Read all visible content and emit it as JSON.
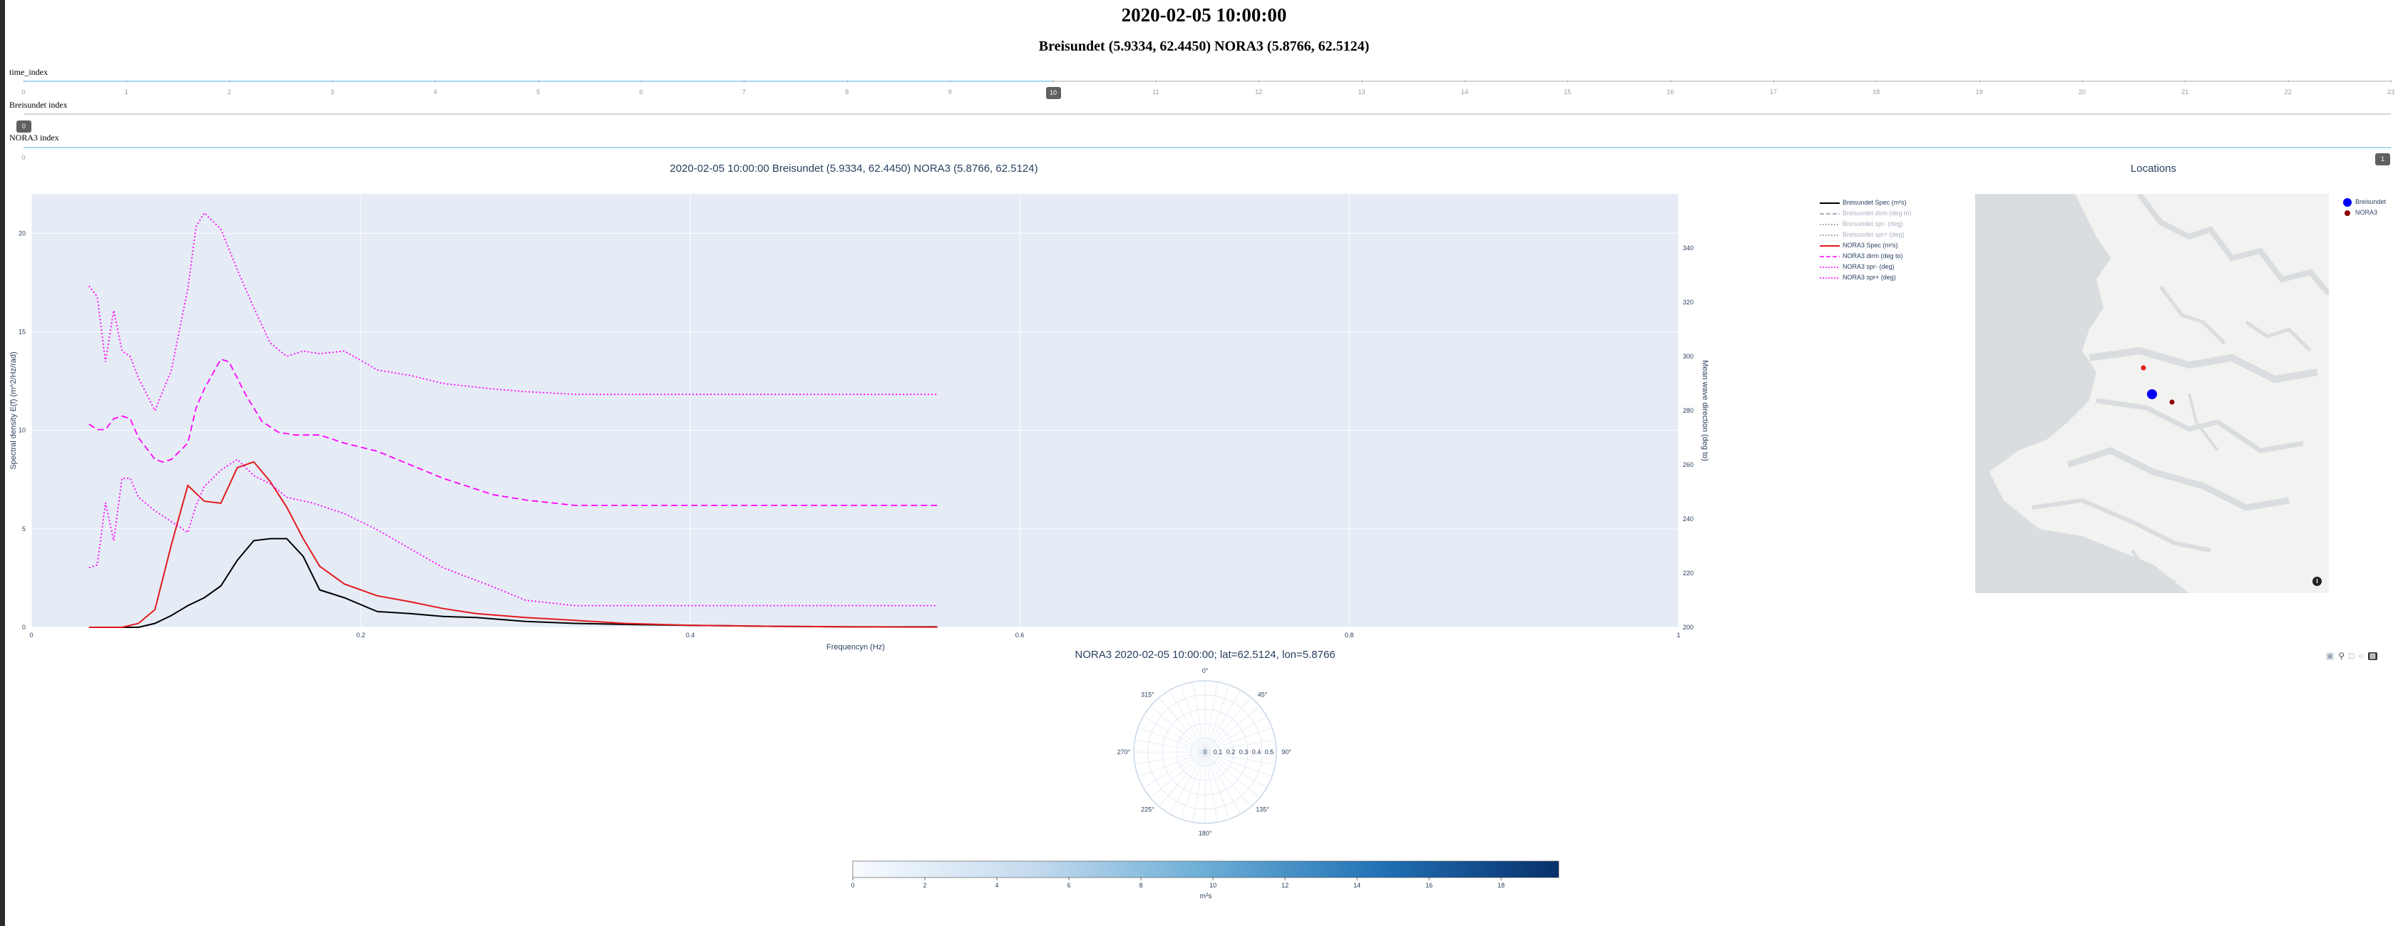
{
  "header": {
    "title": "2020-02-05 10:00:00",
    "subtitle": "Breisundet (5.9334, 62.4450) NORA3 (5.8766, 62.5124)"
  },
  "sliders": [
    {
      "label": "time_index",
      "ticks": [
        "0",
        "1",
        "2",
        "3",
        "4",
        "5",
        "6",
        "7",
        "8",
        "9",
        "10",
        "11",
        "12",
        "13",
        "14",
        "15",
        "16",
        "17",
        "18",
        "19",
        "20",
        "21",
        "22",
        "23"
      ],
      "value": "10",
      "fraction": 0.4348
    },
    {
      "label": "Breisundet index",
      "ticks": [
        "0"
      ],
      "value": "0",
      "fraction": 0.0
    },
    {
      "label": "NORA3 index",
      "ticks": [
        "0"
      ],
      "value": "1",
      "fraction": 1.0
    }
  ],
  "spectrum": {
    "title": "2020-02-05 10:00:00  Breisundet (5.9334, 62.4450)  NORA3 (5.8766, 62.5124)",
    "xlabel": "Frequencyn (Hz)",
    "ylabel": "Spectral density  E(f) (m^2/Hz/rad)",
    "y2label": "Mean wave direction (deg to)",
    "xticks": [
      "0",
      "0.2",
      "0.4",
      "0.6",
      "0.8",
      "1"
    ],
    "yticks": [
      "0",
      "5",
      "10",
      "15",
      "20"
    ],
    "y2ticks": [
      "200",
      "220",
      "240",
      "260",
      "280",
      "300",
      "320",
      "340"
    ]
  },
  "legend": [
    {
      "label": "Breisundet Spec (m²s)",
      "color": "#000000",
      "dash": "solid",
      "faded": false
    },
    {
      "label": "Breisundet dirm (deg to)",
      "color": "#8a96ab",
      "dash": "dash",
      "faded": true
    },
    {
      "label": "Breisundet spr- (deg)",
      "color": "#8a96ab",
      "dash": "dot",
      "faded": true
    },
    {
      "label": "Breisundet spr+ (deg)",
      "color": "#8a96ab",
      "dash": "dot",
      "faded": true
    },
    {
      "label": "NORA3 Spec (m²s)",
      "color": "#e31a1c",
      "dash": "solid",
      "faded": false
    },
    {
      "label": "NORA3 dirm (deg to)",
      "color": "#ff00ff",
      "dash": "dash",
      "faded": false
    },
    {
      "label": "NORA3 spr- (deg)",
      "color": "#ff00ff",
      "dash": "dot",
      "faded": false
    },
    {
      "label": "NORA3 spr+ (deg)",
      "color": "#ff00ff",
      "dash": "dot",
      "faded": false
    }
  ],
  "locations": {
    "title": "Locations",
    "legend": [
      {
        "label": "Breisundet",
        "color": "#0000ff"
      },
      {
        "label": "NORA3",
        "color": "#8b0000"
      }
    ],
    "info_icon": "i"
  },
  "polar": {
    "title": "NORA3 2020-02-05 10:00:00; lat=62.5124, lon=5.8766",
    "angles": [
      "0°",
      "45°",
      "90°",
      "135°",
      "180°",
      "225°",
      "270°",
      "315°"
    ],
    "radial": [
      "0",
      "0.1",
      "0.2",
      "0.3",
      "0.4",
      "0.5"
    ]
  },
  "colorbar": {
    "ticks": [
      "0",
      "2",
      "4",
      "6",
      "8",
      "10",
      "12",
      "14",
      "16",
      "18"
    ],
    "label": "m²s",
    "colors": [
      "#f7fbff",
      "#c6dbef",
      "#6baed6",
      "#2171b5",
      "#08306b"
    ]
  },
  "modebar": [
    "camera-icon",
    "zoom-icon",
    "pan-icon",
    "lasso-icon",
    "plotly-logo-icon"
  ],
  "chart_data": [
    {
      "type": "line",
      "xlim": [
        0,
        1
      ],
      "ylim": [
        0,
        22
      ],
      "y2lim": [
        200,
        360
      ],
      "series": [
        {
          "name": "Breisundet Spec (m²s)",
          "axis": "y",
          "color": "#000000",
          "dash": "solid",
          "x": [
            0.035,
            0.045,
            0.055,
            0.065,
            0.075,
            0.085,
            0.095,
            0.105,
            0.115,
            0.125,
            0.135,
            0.145,
            0.155,
            0.165,
            0.175,
            0.19,
            0.21,
            0.23,
            0.25,
            0.27,
            0.3,
            0.33,
            0.36,
            0.4,
            0.45,
            0.5,
            0.55
          ],
          "y": [
            0,
            0,
            0,
            0,
            0.2,
            0.6,
            1.1,
            1.5,
            2.1,
            3.4,
            4.4,
            4.5,
            4.5,
            3.6,
            1.9,
            1.5,
            0.8,
            0.7,
            0.55,
            0.5,
            0.3,
            0.2,
            0.15,
            0.1,
            0.05,
            0.02,
            0.02
          ]
        },
        {
          "name": "NORA3 Spec (m²s)",
          "axis": "y",
          "color": "#e31a1c",
          "dash": "solid",
          "x": [
            0.035,
            0.045,
            0.055,
            0.065,
            0.075,
            0.085,
            0.095,
            0.105,
            0.115,
            0.125,
            0.135,
            0.145,
            0.155,
            0.165,
            0.175,
            0.19,
            0.21,
            0.23,
            0.25,
            0.27,
            0.3,
            0.33,
            0.36,
            0.4,
            0.45,
            0.5,
            0.55
          ],
          "y": [
            0,
            0,
            0,
            0.2,
            0.9,
            4.2,
            7.2,
            6.4,
            6.3,
            8.1,
            8.4,
            7.4,
            6.1,
            4.5,
            3.1,
            2.2,
            1.6,
            1.3,
            0.95,
            0.7,
            0.5,
            0.35,
            0.2,
            0.1,
            0.05,
            0.02,
            0.01
          ]
        },
        {
          "name": "NORA3 dirm (deg to)",
          "axis": "y2",
          "color": "#ff00ff",
          "dash": "dash",
          "x": [
            0.035,
            0.04,
            0.045,
            0.05,
            0.055,
            0.06,
            0.065,
            0.075,
            0.08,
            0.085,
            0.095,
            0.1,
            0.105,
            0.115,
            0.12,
            0.13,
            0.14,
            0.15,
            0.16,
            0.175,
            0.19,
            0.21,
            0.23,
            0.25,
            0.28,
            0.3,
            0.33,
            0.36,
            0.4,
            0.45,
            0.5,
            0.55
          ],
          "y": [
            275,
            273,
            273,
            277,
            278,
            277,
            270,
            262,
            261,
            262,
            268,
            281,
            288,
            299,
            298,
            286,
            276,
            272,
            271,
            271,
            268,
            265,
            260,
            255,
            249,
            247,
            245,
            245,
            245,
            245,
            245,
            245
          ]
        },
        {
          "name": "NORA3 spr- (deg)",
          "axis": "y2",
          "color": "#ff00ff",
          "dash": "dot",
          "x": [
            0.035,
            0.04,
            0.045,
            0.05,
            0.055,
            0.06,
            0.065,
            0.075,
            0.085,
            0.095,
            0.1,
            0.105,
            0.115,
            0.125,
            0.135,
            0.145,
            0.155,
            0.17,
            0.19,
            0.21,
            0.23,
            0.25,
            0.28,
            0.3,
            0.33,
            0.36,
            0.4,
            0.45,
            0.5,
            0.55
          ],
          "y": [
            222,
            223,
            246,
            232,
            255,
            255,
            248,
            243,
            239,
            235,
            245,
            252,
            258,
            262,
            256,
            253,
            248,
            246,
            242,
            236,
            229,
            222,
            215,
            210,
            208,
            208,
            208,
            208,
            208,
            208
          ]
        },
        {
          "name": "NORA3 spr+ (deg)",
          "axis": "y2",
          "color": "#ff00ff",
          "dash": "dot",
          "x": [
            0.035,
            0.04,
            0.045,
            0.05,
            0.055,
            0.06,
            0.065,
            0.075,
            0.085,
            0.095,
            0.1,
            0.105,
            0.115,
            0.125,
            0.135,
            0.145,
            0.155,
            0.165,
            0.175,
            0.19,
            0.21,
            0.23,
            0.25,
            0.28,
            0.3,
            0.33,
            0.36,
            0.4,
            0.45,
            0.5,
            0.55
          ],
          "y": [
            326,
            322,
            298,
            317,
            302,
            300,
            292,
            280,
            295,
            325,
            348,
            353,
            347,
            332,
            318,
            305,
            300,
            302,
            301,
            302,
            295,
            293,
            290,
            288,
            287,
            286,
            286,
            286,
            286,
            286,
            286
          ]
        }
      ]
    }
  ]
}
